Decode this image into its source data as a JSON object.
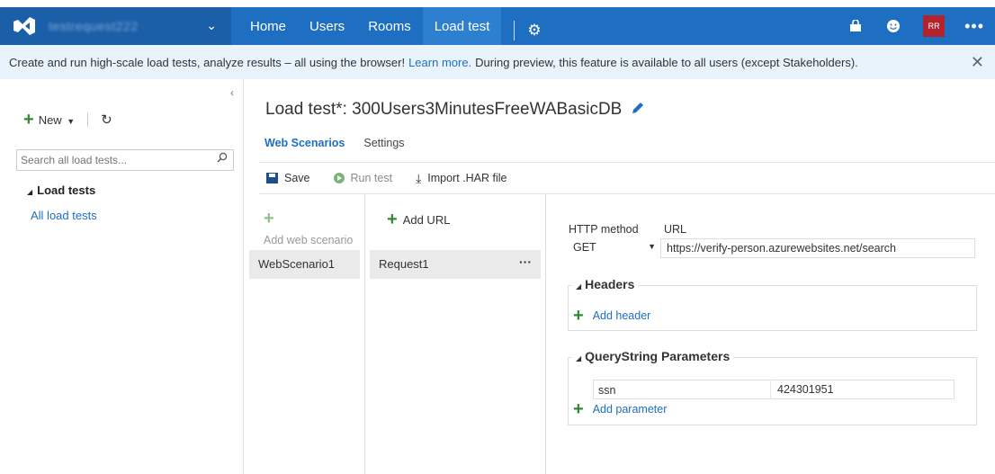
{
  "topbar": {
    "account_name": "testrequest222",
    "nav": [
      "Home",
      "Users",
      "Rooms",
      "Load test"
    ],
    "active_index": 3,
    "avatar_initials": "RR",
    "more": "•••"
  },
  "banner": {
    "text_before": "Create and run high-scale load tests, analyze results – all using the browser!",
    "link": "Learn more.",
    "text_after": "During preview, this feature is available to all users (except Stakeholders).",
    "close": "✕"
  },
  "left_panel": {
    "collapse": "‹",
    "new_label": "New",
    "search_placeholder": "Search all load tests...",
    "tree_header": "Load tests",
    "tree_link": "All load tests"
  },
  "main": {
    "title": "Load test*: 300Users3MinutesFreeWABasicDB",
    "tabs": [
      "Web Scenarios",
      "Settings"
    ],
    "toolbar": {
      "save": "Save",
      "run": "Run test",
      "import": "Import .HAR file"
    }
  },
  "scenarios": {
    "add_label": "Add web scenario",
    "items": [
      "WebScenario1"
    ]
  },
  "requests": {
    "add_label": "Add URL",
    "items": [
      "Request1"
    ],
    "more": "···"
  },
  "details": {
    "method_label": "HTTP method",
    "url_label": "URL",
    "method_value": "GET",
    "url_value": "https://verify-person.azurewebsites.net/search",
    "headers_title": "Headers",
    "add_header": "Add header",
    "query_title": "QueryString Parameters",
    "params": [
      {
        "key": "ssn",
        "value": "424301951"
      }
    ],
    "add_parameter": "Add parameter"
  },
  "colors": {
    "topbar": "#1e6fc2",
    "brand": "#1b5fa8",
    "banner": "#e9f3fc",
    "link": "#1e6fc2",
    "plus": "#2f8a2f",
    "avatar": "#b3232e"
  }
}
